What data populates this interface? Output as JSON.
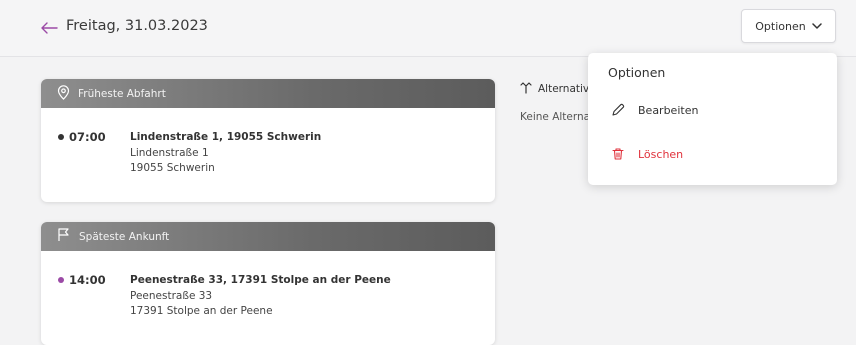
{
  "header": {
    "back_icon": "arrow-left-icon",
    "title": "Freitag, 31.03.2023",
    "options_label": "Optionen",
    "options_icon": "chevron-down-icon"
  },
  "cards": {
    "departure": {
      "title": "Früheste Abfahrt",
      "icon": "map-pin-icon",
      "time": "07:00",
      "dot_color": "#333333",
      "address_main": "Lindenstraße 1, 19055 Schwerin",
      "address_line1": "Lindenstraße 1",
      "address_line2": "19055 Schwerin"
    },
    "arrival": {
      "title": "Späteste Ankunft",
      "icon": "flag-icon",
      "time": "14:00",
      "dot_color": "#9b4aa6",
      "address_main": "Peenestraße 33, 17391 Stolpe an der Peene",
      "address_line1": "Peenestraße 33",
      "address_line2": "17391 Stolpe an der Peene"
    }
  },
  "alternatives": {
    "title": "Alternativ",
    "icon": "split-arrows-icon",
    "empty_text": "Keine Alterna"
  },
  "dropdown": {
    "title": "Optionen",
    "items": [
      {
        "label": "Bearbeiten",
        "icon": "pencil-icon",
        "color": "#333333"
      },
      {
        "label": "Löschen",
        "icon": "trash-icon",
        "color": "#e0323c"
      }
    ]
  },
  "colors": {
    "accent": "#9b4aa6",
    "danger": "#e0323c"
  }
}
